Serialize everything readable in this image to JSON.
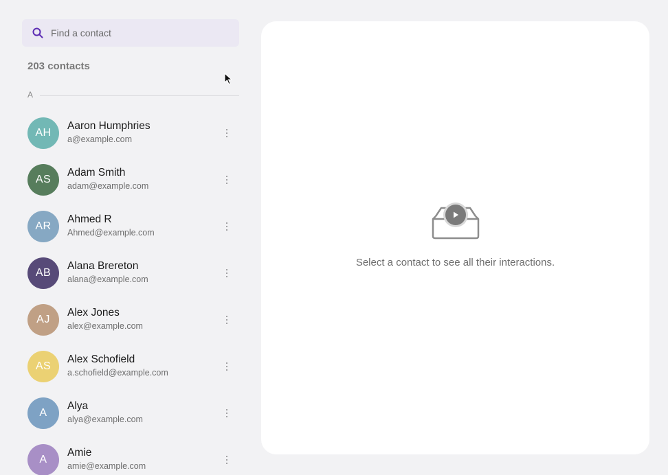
{
  "search": {
    "placeholder": "Find a contact"
  },
  "contacts_count": "203 contacts",
  "section_letter": "A",
  "contacts": [
    {
      "initials": "AH",
      "name": "Aaron Humphries",
      "email": "a@example.com",
      "color": "#72b8b5"
    },
    {
      "initials": "AS",
      "name": "Adam Smith",
      "email": "adam@example.com",
      "color": "#577d5c"
    },
    {
      "initials": "AR",
      "name": "Ahmed R",
      "email": "Ahmed@example.com",
      "color": "#86a8c3"
    },
    {
      "initials": "AB",
      "name": "Alana Brereton",
      "email": "alana@example.com",
      "color": "#574a78"
    },
    {
      "initials": "AJ",
      "name": "Alex Jones",
      "email": "alex@example.com",
      "color": "#c0a085"
    },
    {
      "initials": "AS",
      "name": "Alex Schofield",
      "email": "a.schofield@example.com",
      "color": "#ebd173"
    },
    {
      "initials": "A",
      "name": "Alya",
      "email": "alya@example.com",
      "color": "#7ea2c4"
    },
    {
      "initials": "A",
      "name": "Amie",
      "email": "amie@example.com",
      "color": "#a88fc6"
    }
  ],
  "empty_state": {
    "message": "Select a contact to see all their interactions."
  },
  "icons": {
    "search": "search-icon",
    "more": "more-vertical-icon",
    "inbox": "inbox-tray-icon",
    "play": "play-icon",
    "cursor": "mouse-cursor-icon"
  },
  "colors": {
    "accent": "#5b2bb3",
    "search_bg": "#ebe8f3",
    "page_bg": "#f2f2f4"
  }
}
